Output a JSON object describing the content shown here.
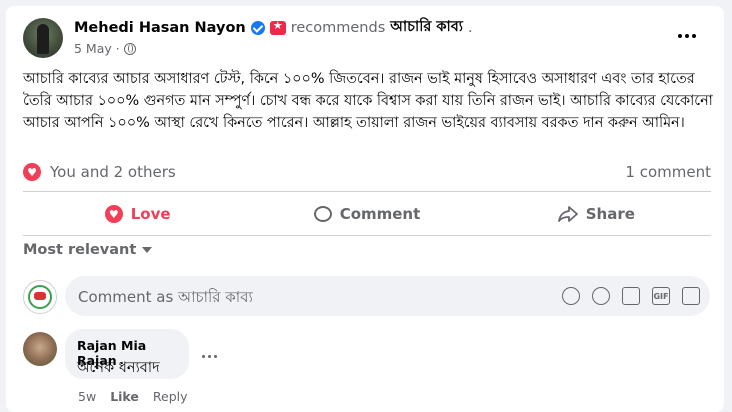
{
  "post": {
    "author": "Mehedi Hasan Nayon",
    "recommends_word": "recommends",
    "page_name": "আচারি কাব্য",
    "page_suffix": ".",
    "date": "5 May",
    "date_separator": "·",
    "text": "আচারি কাব্যের আচার অসাধারণ টেস্ট, কিনে ১০০% জিতবেন। রাজন ভাই মানুষ হিসাবেও অসাধারণ এবং তার হাতের তৈরি আচার ১০০% গুনগত মান সম্পুর্ণ। চোখ বন্ধ করে যাকে বিশ্বাস করা যায় তিনি রাজন ভাই। আচারি কাব্যের যেকোনো আচার আপনি ১০০% আস্থা রেখে কিনতে পারেন। আল্লাহ তায়ালা রাজন ভাইয়ের ব্যাবসায় বরকত দান করুন আমিন।"
  },
  "reactions": {
    "summary": "You and 2 others",
    "comments_count": "1 comment"
  },
  "actions": {
    "love": "Love",
    "comment": "Comment",
    "share": "Share"
  },
  "sort": {
    "label": "Most relevant"
  },
  "composer": {
    "placeholder": "Comment as আচারি কাব্য"
  },
  "comment": {
    "author": "Rajan Mia Rajan",
    "text": "অনেক ধন্যবাদ",
    "age": "5w",
    "like": "Like",
    "reply": "Reply"
  },
  "colors": {
    "love": "#f33e58",
    "verified": "#1877f2",
    "muted": "#65676b",
    "background": "#f0f2f5"
  }
}
